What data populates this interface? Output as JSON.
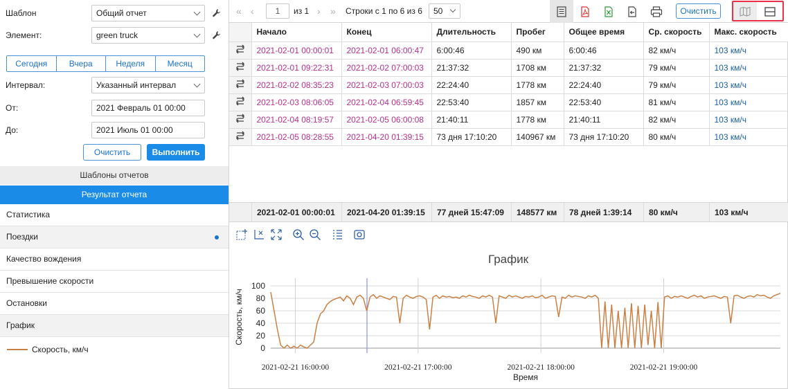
{
  "filters": {
    "template_label": "Шаблон",
    "template_value": "Общий отчет",
    "element_label": "Элемент:",
    "element_value": "green truck",
    "period_buttons": [
      "Сегодня",
      "Вчера",
      "Неделя",
      "Месяц"
    ],
    "interval_label": "Интервал:",
    "interval_value": "Указанный интервал",
    "from_label": "От:",
    "from_value": "2021 Февраль 01 00:00",
    "to_label": "До:",
    "to_value": "2021 Июль 01 00:00",
    "clear_label": "Очистить",
    "run_label": "Выполнить"
  },
  "sections": {
    "templates": "Шаблоны отчетов",
    "result": "Результат отчета"
  },
  "menu": [
    "Статистика",
    "Поездки",
    "Качество вождения",
    "Превышение скорости",
    "Остановки",
    "График"
  ],
  "legend": {
    "series_label": "Скорость, км/ч",
    "color": "#c98044"
  },
  "toolbar": {
    "page": "1",
    "of_pages": "из 1",
    "rows_info": "Строки с 1 по 6 из 6",
    "per_page": "50",
    "clear_label": "Очистить"
  },
  "table": {
    "headers": [
      "Начало",
      "Конец",
      "Длительность",
      "Пробег",
      "Общее время",
      "Ср. скорость",
      "Макс. скорость"
    ],
    "rows": [
      [
        "2021-02-01 00:00:01",
        "2021-02-01 06:00:47",
        "6:00:46",
        "490 км",
        "6:00:46",
        "82 км/ч",
        "103 км/ч"
      ],
      [
        "2021-02-01 09:22:31",
        "2021-02-02 07:00:03",
        "21:37:32",
        "1708 км",
        "21:37:32",
        "79 км/ч",
        "103 км/ч"
      ],
      [
        "2021-02-02 08:35:23",
        "2021-02-03 07:00:03",
        "22:24:40",
        "1778 км",
        "22:24:40",
        "79 км/ч",
        "103 км/ч"
      ],
      [
        "2021-02-03 08:06:05",
        "2021-02-04 06:59:45",
        "22:53:40",
        "1857 км",
        "22:53:40",
        "81 км/ч",
        "103 км/ч"
      ],
      [
        "2021-02-04 08:19:57",
        "2021-02-05 06:00:08",
        "21:40:11",
        "1778 км",
        "21:40:11",
        "82 км/ч",
        "103 км/ч"
      ],
      [
        "2021-02-05 08:28:55",
        "2021-04-20 01:39:15",
        "73 дня 17:10:20",
        "140967 км",
        "73 дня 17:10:20",
        "80 км/ч",
        "103 км/ч"
      ]
    ],
    "totals": [
      "2021-02-01 00:00:01",
      "2021-04-20 01:39:15",
      "77 дней 15:47:09",
      "148577 км",
      "78 дней 1:39:14",
      "80 км/ч",
      "103 км/ч"
    ]
  },
  "chart_data": {
    "type": "line",
    "title": "График",
    "xlabel": "Время",
    "ylabel": "Скорость, км/ч",
    "x_ticks": [
      "2021-02-21 16:00:00",
      "2021-02-21 17:00:00",
      "2021-02-21 18:00:00",
      "2021-02-21 19:00:00"
    ],
    "ylim": [
      0,
      100
    ],
    "y_ticks": [
      0,
      20,
      40,
      60,
      80,
      100
    ],
    "grid": true,
    "series": [
      {
        "name": "Скорость, км/ч",
        "color": "#c98044",
        "x_range_hours": [
          15.8,
          19.95
        ],
        "values": [
          90,
          60,
          30,
          5,
          0,
          5,
          0,
          3,
          0,
          5,
          2,
          0,
          5,
          10,
          40,
          55,
          60,
          70,
          75,
          78,
          80,
          82,
          76,
          84,
          80,
          70,
          82,
          85,
          80,
          60,
          82,
          86,
          80,
          84,
          82,
          80,
          78,
          83,
          82,
          40,
          80,
          85,
          82,
          80,
          83,
          84,
          82,
          78,
          30,
          82,
          85,
          80,
          84,
          82,
          83,
          81,
          82,
          80,
          84,
          82,
          85,
          83,
          82,
          80,
          84,
          82,
          85,
          82,
          40,
          84,
          82,
          80,
          85,
          82,
          84,
          82,
          80,
          83,
          82,
          84,
          81,
          82,
          85,
          80,
          82,
          84,
          83,
          50,
          82,
          80,
          85,
          82,
          84,
          83,
          82,
          80,
          84,
          82,
          85,
          80,
          0,
          75,
          0,
          70,
          0,
          60,
          0,
          65,
          0,
          72,
          0,
          68,
          0,
          70,
          5,
          60,
          0,
          74,
          0,
          82,
          84,
          80,
          83,
          82,
          84,
          82,
          80,
          83,
          85,
          82,
          84,
          80,
          82,
          83,
          84,
          82,
          80,
          83,
          82,
          40,
          84,
          85,
          82,
          80,
          83,
          84,
          82,
          86,
          84,
          85,
          82,
          80,
          84,
          86,
          88
        ]
      }
    ]
  }
}
